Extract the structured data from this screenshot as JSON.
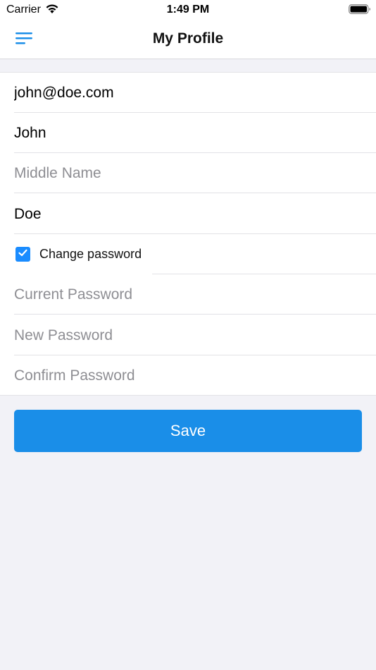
{
  "status_bar": {
    "carrier": "Carrier",
    "time": "1:49 PM",
    "wifi_icon": "wifi-icon",
    "battery_icon": "battery-icon"
  },
  "nav": {
    "title": "My Profile",
    "menu_icon": "hamburger-menu-icon"
  },
  "form": {
    "email": {
      "value": "john@doe.com",
      "placeholder": ""
    },
    "first_name": {
      "value": "John",
      "placeholder": ""
    },
    "middle_name": {
      "value": "",
      "placeholder": "Middle Name"
    },
    "last_name": {
      "value": "Doe",
      "placeholder": ""
    },
    "change_password": {
      "label": "Change password",
      "checked": true
    },
    "current_password": {
      "value": "",
      "placeholder": "Current Password"
    },
    "new_password": {
      "value": "",
      "placeholder": "New Password"
    },
    "confirm_password": {
      "value": "",
      "placeholder": "Confirm Password"
    }
  },
  "save_button": {
    "label": "Save"
  },
  "colors": {
    "accent": "#1a8ee8",
    "checkbox": "#1a8cff",
    "background": "#f2f2f7",
    "placeholder": "#8e8e93"
  }
}
